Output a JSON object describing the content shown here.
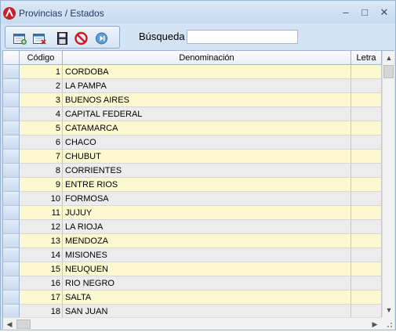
{
  "window": {
    "title": "Provincias / Estados",
    "controls": {
      "minimize": "–",
      "maximize": "□",
      "close": "✕"
    }
  },
  "toolbar": {
    "buttons": [
      {
        "name": "add-record-button",
        "icon": "calendar-add-icon"
      },
      {
        "name": "delete-record-button",
        "icon": "calendar-delete-icon"
      },
      {
        "name": "save-button",
        "icon": "floppy-disk-icon"
      },
      {
        "name": "cancel-button",
        "icon": "no-entry-icon"
      },
      {
        "name": "next-button",
        "icon": "play-circle-icon"
      }
    ],
    "search_label": "Búsqueda",
    "search_value": ""
  },
  "grid": {
    "columns": [
      "Código",
      "Denominación",
      "Letra"
    ],
    "rows": [
      {
        "code": "1",
        "name": "CORDOBA",
        "letter": ""
      },
      {
        "code": "2",
        "name": "LA PAMPA",
        "letter": ""
      },
      {
        "code": "3",
        "name": "BUENOS AIRES",
        "letter": ""
      },
      {
        "code": "4",
        "name": "CAPITAL FEDERAL",
        "letter": ""
      },
      {
        "code": "5",
        "name": "CATAMARCA",
        "letter": ""
      },
      {
        "code": "6",
        "name": "CHACO",
        "letter": ""
      },
      {
        "code": "7",
        "name": "CHUBUT",
        "letter": ""
      },
      {
        "code": "8",
        "name": "CORRIENTES",
        "letter": ""
      },
      {
        "code": "9",
        "name": "ENTRE RIOS",
        "letter": ""
      },
      {
        "code": "10",
        "name": "FORMOSA",
        "letter": ""
      },
      {
        "code": "11",
        "name": "JUJUY",
        "letter": ""
      },
      {
        "code": "12",
        "name": "LA RIOJA",
        "letter": ""
      },
      {
        "code": "13",
        "name": "MENDOZA",
        "letter": ""
      },
      {
        "code": "14",
        "name": "MISIONES",
        "letter": ""
      },
      {
        "code": "15",
        "name": "NEUQUEN",
        "letter": ""
      },
      {
        "code": "16",
        "name": "RIO NEGRO",
        "letter": ""
      },
      {
        "code": "17",
        "name": "SALTA",
        "letter": ""
      },
      {
        "code": "18",
        "name": "SAN JUAN",
        "letter": ""
      }
    ]
  },
  "scrollbars": {
    "up": "▲",
    "down": "▼",
    "left": "◀",
    "right": "▶"
  },
  "colors": {
    "odd_row": "#fcf9d0",
    "even_row": "#ececec",
    "title_text": "#1e395b",
    "app_icon": "#c8202a"
  }
}
